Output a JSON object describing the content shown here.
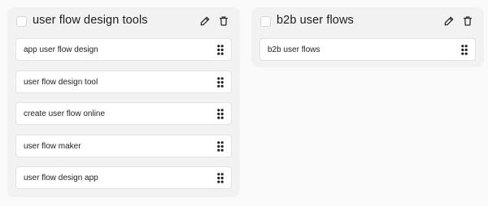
{
  "groups": [
    {
      "title": "user flow design tools",
      "cards": [
        "app user flow design",
        "user flow design tool",
        "create user flow online",
        "user flow maker",
        "user flow design app"
      ]
    },
    {
      "title": "b2b user flows",
      "cards": [
        "b2b user flows"
      ]
    }
  ],
  "icons": {
    "edit": "pencil-icon",
    "delete": "trash-icon",
    "drag": "drag-handle-icon"
  }
}
